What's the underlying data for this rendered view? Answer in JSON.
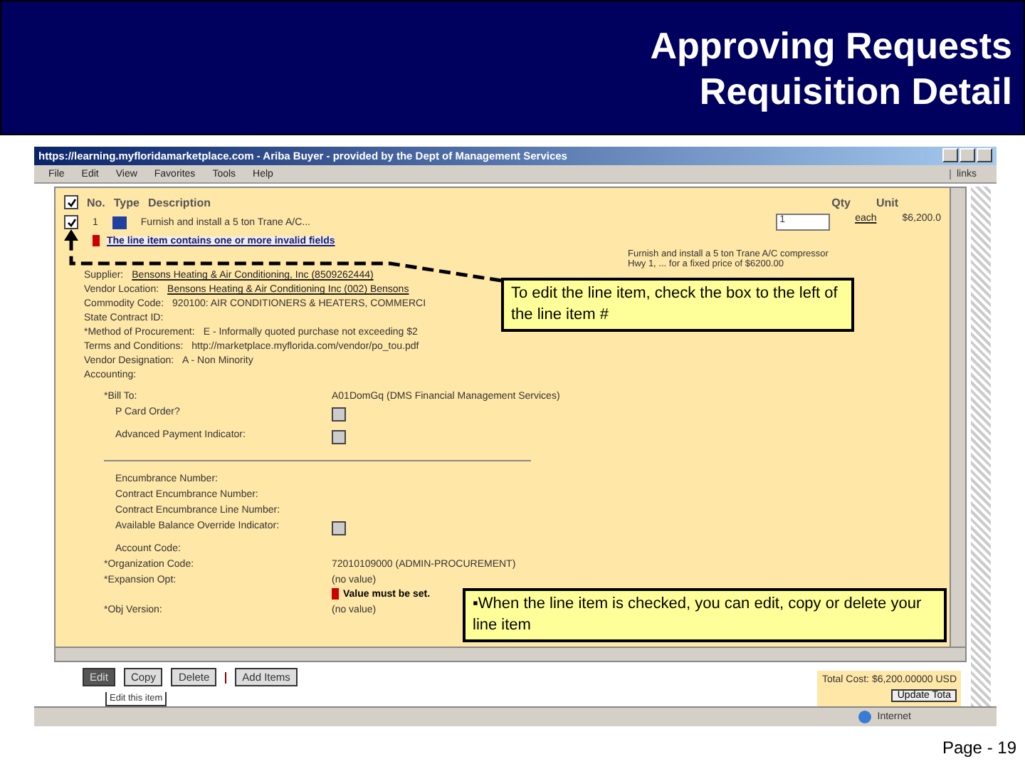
{
  "slide": {
    "title_lines": [
      "Approving Requests",
      "Requisition Detail"
    ],
    "page": "Page - 19"
  },
  "browser": {
    "title": "https://learning.myfloridamarketplace.com - Ariba Buyer - provided by the Dept of Management Services",
    "menu": [
      "File",
      "Edit",
      "View",
      "Favorites",
      "Tools",
      "Help"
    ],
    "links": "links",
    "status": "Internet"
  },
  "table": {
    "header_checked": true,
    "columns": [
      "No.",
      "Type",
      "Description"
    ],
    "qty_column": "Qty",
    "unit_column": "Unit",
    "item": {
      "checked": true,
      "number": "1",
      "description": "Furnish and install a 5 ton Trane A/C...",
      "qty": "1",
      "unit": "each",
      "price": "$6,200.0",
      "error": "The line item contains one or more invalid fields",
      "details": [
        "Furnish and install a 5 ton Trane A/C compressor",
        "Hwy 1, ... for a fixed price of $6200.00"
      ]
    }
  },
  "supplier_fields": [
    {
      "kind": "link",
      "label": "Supplier:",
      "value": "Bensons Heating & Air Conditioning, Inc (8509262444)"
    },
    {
      "kind": "link",
      "label": "Vendor Location:",
      "value": "Bensons Heating & Air Conditioning Inc (002) Bensons"
    },
    {
      "kind": "text",
      "label": "Commodity Code:",
      "value": "920100: AIR CONDITIONERS & HEATERS, COMMERCI"
    },
    {
      "kind": "label",
      "label": "State Contract ID:"
    },
    {
      "kind": "text",
      "label": "*Method of Procurement:",
      "value": "E - Informally quoted purchase not exceeding $2"
    },
    {
      "kind": "text",
      "label": "Terms and Conditions:",
      "value": "http://marketplace.myflorida.com/vendor/po_tou.pdf"
    },
    {
      "kind": "text",
      "label": "Vendor Designation:",
      "value": "A - Non Minority"
    },
    {
      "kind": "label",
      "label": "Accounting:"
    }
  ],
  "accounting_fields": [
    {
      "kind": "text",
      "label": "*Bill To:",
      "value": "A01DomGq (DMS Financial Management Services)"
    },
    {
      "kind": "checkbox",
      "label": "P Card Order?",
      "checked": false
    },
    {
      "kind": "checkbox",
      "label": "Advanced Payment Indicator:",
      "checked": false
    },
    {
      "kind": "divider"
    },
    {
      "kind": "label",
      "label": "Encumbrance Number:"
    },
    {
      "kind": "label",
      "label": "Contract Encumbrance Number:"
    },
    {
      "kind": "label",
      "label": "Contract Encumbrance Line Number:"
    },
    {
      "kind": "checkbox",
      "label": "Available Balance Override Indicator:",
      "checked": false
    },
    {
      "kind": "label",
      "label": "Account Code:"
    },
    {
      "kind": "text",
      "label": "*Organization Code:",
      "value": "72010109000 (ADMIN-PROCUREMENT)"
    },
    {
      "kind": "error",
      "label": "*Expansion Opt:",
      "value": "(no value)",
      "error": "Value must be set."
    },
    {
      "kind": "text",
      "label": "*Obj Version:",
      "value": "(no value)"
    }
  ],
  "actions": [
    {
      "label": "Edit",
      "selected": true
    },
    {
      "label": "Copy",
      "selected": false
    },
    {
      "label": "Delete",
      "selected": false
    },
    {
      "label": "Add Items",
      "selected": false
    }
  ],
  "tooltip": "Edit this item",
  "total": "Total Cost: $6,200.00000 USD",
  "update_button": "Update Tota",
  "callouts": [
    "To edit the line item, check the box to the left of the line item #",
    "▪When the line item is checked, you can edit, copy or delete your line item"
  ]
}
